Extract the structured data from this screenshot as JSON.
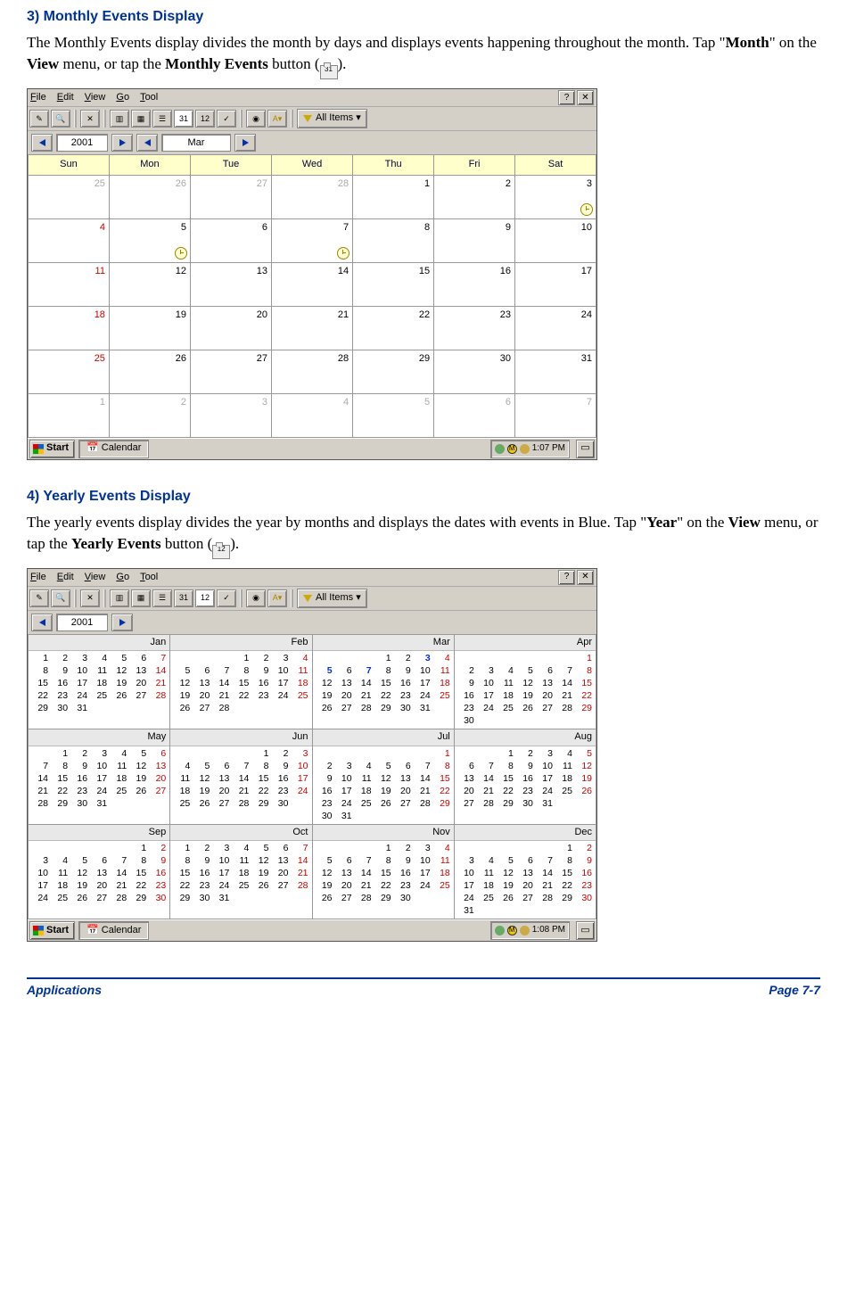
{
  "section3": {
    "title": "3)   Monthly Events Display",
    "para": "The Monthly Events display divides the month by days and displays events happening throughout the month. Tap \"",
    "month_b": "Month",
    "para2": "\" on the ",
    "view_b": "View",
    "para3": " menu, or tap the ",
    "me_b": "Monthly Events",
    "para4": " button (",
    "icon_num": "31",
    "para5": ")."
  },
  "section4": {
    "title": "4)   Yearly Events Display",
    "para": "The yearly events display divides the year by months and displays the dates with events in Blue. Tap \"",
    "year_b": "Year",
    "para2": "\" on the ",
    "view_b": "View",
    "para3": " menu, or tap the ",
    "ye_b": "Yearly Events",
    "para4": " button (",
    "icon_num": "12",
    "para5": ")."
  },
  "menus": {
    "file": "File",
    "edit": "Edit",
    "view": "View",
    "go": "Go",
    "tool": "Tool"
  },
  "winbtn": {
    "help": "?",
    "close": "✕"
  },
  "filter": {
    "label": "All Items ▾"
  },
  "nav1": {
    "year": "2001",
    "month": "Mar"
  },
  "nav2": {
    "year": "2001"
  },
  "dowhead": {
    "sun": "Sun",
    "mon": "Mon",
    "tue": "Tue",
    "wed": "Wed",
    "thu": "Thu",
    "fri": "Fri",
    "sat": "Sat"
  },
  "monthcells": {
    "r0": [
      "25",
      "26",
      "27",
      "28",
      "1",
      "2",
      "3"
    ],
    "r1": [
      "4",
      "5",
      "6",
      "7",
      "8",
      "9",
      "10"
    ],
    "r2": [
      "11",
      "12",
      "13",
      "14",
      "15",
      "16",
      "17"
    ],
    "r3": [
      "18",
      "19",
      "20",
      "21",
      "22",
      "23",
      "24"
    ],
    "r4": [
      "25",
      "26",
      "27",
      "28",
      "29",
      "30",
      "31"
    ],
    "r5": [
      "1",
      "2",
      "3",
      "4",
      "5",
      "6",
      "7"
    ]
  },
  "taskbar": {
    "start": "Start",
    "app": "Calendar",
    "time1": "1:07 PM",
    "time2": "1:08 PM"
  },
  "months": {
    "jan": "Jan",
    "feb": "Feb",
    "mar": "Mar",
    "apr": "Apr",
    "may": "May",
    "jun": "Jun",
    "jul": "Jul",
    "aug": "Aug",
    "sep": "Sep",
    "oct": "Oct",
    "nov": "Nov",
    "dec": "Dec"
  },
  "year_data": {
    "jan": {
      "leading": 0,
      "days": 31,
      "evt": []
    },
    "feb": {
      "leading": 3,
      "days": 28,
      "evt": []
    },
    "mar": {
      "leading": 3,
      "days": 31,
      "evt": [
        3,
        5,
        7
      ]
    },
    "apr": {
      "leading": 6,
      "days": 30,
      "evt": []
    },
    "may": {
      "leading": 1,
      "days": 31,
      "evt": []
    },
    "jun": {
      "leading": 4,
      "days": 30,
      "evt": []
    },
    "jul": {
      "leading": 6,
      "days": 31,
      "evt": []
    },
    "aug": {
      "leading": 2,
      "days": 31,
      "evt": []
    },
    "sep": {
      "leading": 5,
      "days": 30,
      "evt": []
    },
    "oct": {
      "leading": 0,
      "days": 31,
      "evt": []
    },
    "nov": {
      "leading": 3,
      "days": 30,
      "evt": []
    },
    "dec": {
      "leading": 5,
      "days": 31,
      "evt": []
    }
  },
  "footer": {
    "left": "Applications",
    "right": "Page 7-7"
  }
}
